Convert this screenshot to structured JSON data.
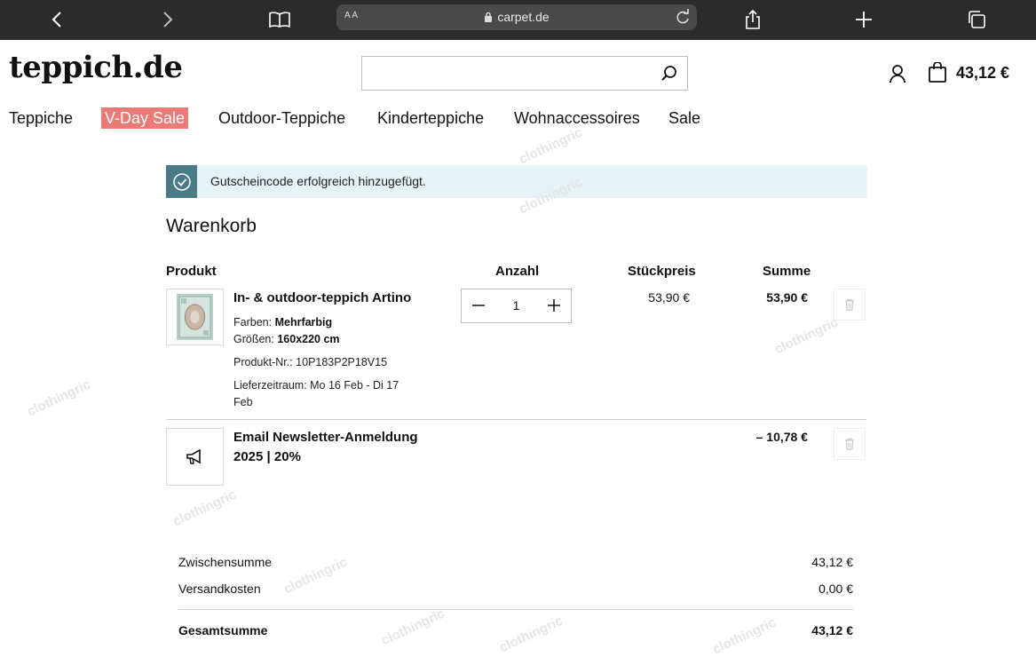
{
  "browser": {
    "url": "carpet.de",
    "text_size_label": "A A",
    "icons": [
      "back-icon",
      "forward-icon",
      "bookmarks-icon",
      "share-icon",
      "new-tab-icon",
      "tabs-icon"
    ]
  },
  "site": {
    "logo": "teppich.de",
    "cart_total": "43,12 €",
    "nav": [
      "Teppiche",
      "V-Day Sale",
      "Outdoor-Teppiche",
      "Kinderteppiche",
      "Wohnaccessoires",
      "Sale"
    ],
    "highlight_color": "#e97a76"
  },
  "notice": {
    "text": "Gutscheincode erfolgreich hinzugefügt.",
    "icon_color": "#497a86"
  },
  "cart": {
    "title": "Warenkorb",
    "headers": {
      "product": "Produkt",
      "qty": "Anzahl",
      "unit_price": "Stückpreis",
      "total": "Summe"
    },
    "item": {
      "name": "In- & outdoor-teppich Artino",
      "color_label": "Farben:",
      "color_value": "Mehrfarbig",
      "size_label": "Größen:",
      "size_value": "160x220 cm",
      "sku": "Produkt-Nr.: 10P183P2P18V15",
      "delivery_line1": "Lieferzeitraum: Mo 16 Feb - Di 17",
      "delivery_line2": "Feb",
      "quantity": "1",
      "unit_price": "53,90 €",
      "total": "53,90 €"
    },
    "coupon": {
      "name_line1": "Email Newsletter-Anmeldung",
      "name_line2": "2025 | 20%",
      "total": "– 10,78 €"
    }
  },
  "summary": {
    "subtotal_label": "Zwischensumme",
    "subtotal": "43,12 €",
    "shipping_label": "Versandkosten",
    "shipping": "0,00 €",
    "grand_total_label": "Gesamtsumme",
    "grand_total": "43,12 €"
  },
  "watermark": "clothingric"
}
